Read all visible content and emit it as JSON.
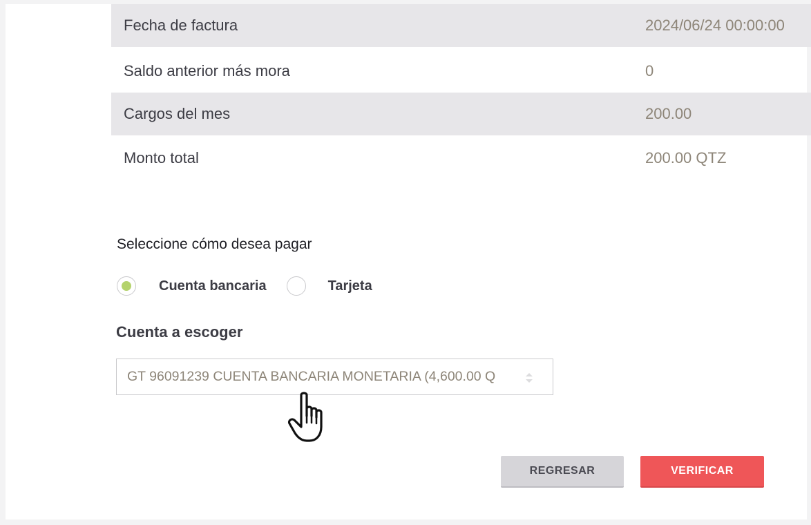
{
  "summary": {
    "rows": [
      {
        "label": "Fecha de factura",
        "value": "2024/06/24 00:00:00"
      },
      {
        "label": "Saldo anterior más mora",
        "value": "0"
      },
      {
        "label": "Cargos del mes",
        "value": "200.00"
      },
      {
        "label": "Monto total",
        "value": "200.00 QTZ"
      }
    ]
  },
  "payment": {
    "prompt": "Seleccione cómo desea pagar",
    "options": [
      {
        "label": "Cuenta bancaria",
        "selected": true
      },
      {
        "label": "Tarjeta",
        "selected": false
      }
    ],
    "accent_color": "#b4d36c"
  },
  "account": {
    "title": "Cuenta a escoger",
    "selected_value": "GT 96091239 CUENTA BANCARIA MONETARIA  (4,600.00 Q",
    "icon": "select-arrows-icon"
  },
  "buttons": {
    "back_label": "REGRESAR",
    "verify_label": "VERIFICAR",
    "verify_color": "#ef5658"
  },
  "cursor": {
    "icon": "hand-pointer-icon"
  }
}
